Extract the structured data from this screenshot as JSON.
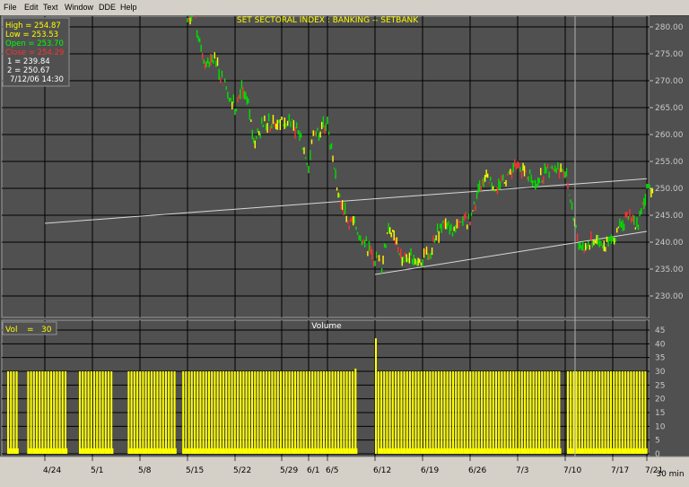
{
  "menu": {
    "file": "File",
    "edit": "Edit",
    "text": "Text",
    "window": "Window",
    "dde": "DDE",
    "help": "Help"
  },
  "chart_data": {
    "type": "line",
    "title": "SET SECTORAL INDEX : BANKING -- SETBANK",
    "info": {
      "high": "High   =  254.87",
      "low": "Low    =  253.53",
      "open": "Open   =  253.70",
      "close": "Close  =  254.29",
      "p1": "1    =  239.84",
      "p2": "2    =  250.67",
      "datetime": "7/12/06   14:30"
    },
    "price_axis": {
      "ylim": [
        225,
        283
      ],
      "ticks": [
        "280.00",
        "275.00",
        "270.00",
        "265.00",
        "260.00",
        "255.00",
        "250.00",
        "245.00",
        "240.00",
        "235.00",
        "230.00"
      ]
    },
    "x_labels": [
      "4/24",
      "5/1",
      "5/8",
      "5/15",
      "5/22",
      "5/29",
      "6/1",
      "6/5",
      "6/12",
      "6/19",
      "6/26",
      "7/3",
      "7/10",
      "7/17",
      "7/21"
    ],
    "x_unit": "30  min",
    "price_series": {
      "name": "SETBANK",
      "dates": [
        "5/15",
        "5/16",
        "5/17",
        "5/18",
        "5/19",
        "5/22",
        "5/23",
        "5/24",
        "5/25",
        "5/26",
        "5/29",
        "5/30",
        "5/31",
        "6/1",
        "6/2",
        "6/5",
        "6/6",
        "6/7",
        "6/8",
        "6/9",
        "6/12",
        "6/13",
        "6/14",
        "6/15",
        "6/16",
        "6/19",
        "6/20",
        "6/21",
        "6/22",
        "6/23",
        "6/26",
        "6/27",
        "6/28",
        "6/29",
        "6/30",
        "7/3",
        "7/4",
        "7/5",
        "7/6",
        "7/7",
        "7/10",
        "7/11",
        "7/12",
        "7/13",
        "7/14",
        "7/17",
        "7/18",
        "7/19",
        "7/20",
        "7/21"
      ],
      "values": [
        281,
        282.5,
        275.5,
        273,
        274,
        265,
        268,
        265,
        258,
        262,
        262,
        263,
        260,
        254,
        260,
        262,
        253,
        248,
        244,
        243,
        237,
        236,
        243,
        240,
        237,
        237,
        238,
        241,
        243,
        242,
        244,
        248,
        252,
        251,
        250,
        255,
        253,
        252,
        251,
        253,
        254,
        246,
        240,
        239,
        240,
        240,
        244,
        245,
        243,
        250
      ]
    },
    "trendlines": [
      {
        "name": "1",
        "from": [
          "4/24",
          243.5
        ],
        "to": [
          "7/21",
          251.8
        ]
      },
      {
        "name": "2",
        "from": [
          "6/12",
          234
        ],
        "to": [
          "7/21",
          242
        ]
      }
    ],
    "volume": {
      "title": "Volume",
      "label": "Vol",
      "value": "30",
      "ylim": [
        0,
        47
      ],
      "ticks": [
        "45",
        "40",
        "35",
        "30",
        "25",
        "20",
        "15",
        "10",
        "5",
        "0"
      ],
      "typical_bar": 30,
      "spikes": [
        {
          "date": "6/12",
          "value": 42
        },
        {
          "date": "6/9",
          "value": 31
        }
      ],
      "gaps": [
        [
          "4/20",
          "4/20"
        ],
        [
          "4/27",
          "4/28"
        ],
        [
          "5/4",
          "5/5"
        ],
        [
          "5/13",
          "5/13"
        ],
        [
          "6/9",
          "6/11"
        ],
        [
          "7/9",
          "7/9"
        ]
      ]
    }
  }
}
